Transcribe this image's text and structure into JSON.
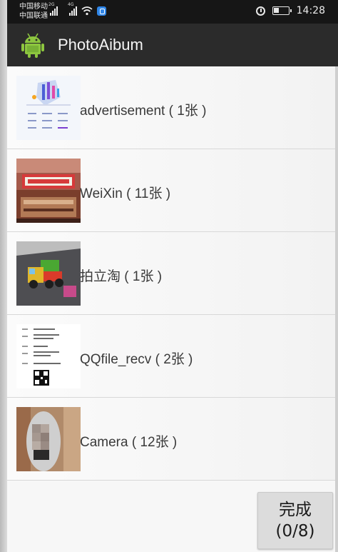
{
  "status_bar": {
    "carrier_1": "中国移动",
    "carrier_2": "中国联通",
    "network_1": "2G",
    "network_2": "4G",
    "time": "14:28"
  },
  "app": {
    "title": "PhotoAibum",
    "icon": "android-robot-icon"
  },
  "albums": [
    {
      "label": "advertisement ( 1张 )",
      "thumb": "advertisement-thumbnail"
    },
    {
      "label": "WeiXin ( 11张 )",
      "thumb": "weixin-thumbnail"
    },
    {
      "label": "拍立淘 ( 1张 )",
      "thumb": "pailitao-thumbnail"
    },
    {
      "label": "QQfile_recv ( 2张 )",
      "thumb": "qqfile-thumbnail"
    },
    {
      "label": "Camera ( 12张 )",
      "thumb": "camera-thumbnail"
    }
  ],
  "done_button": {
    "line1": "完成",
    "line2": "(0/8)"
  },
  "colors": {
    "app_bar": "#2b2b2b",
    "status_bar": "#161616",
    "list_bg": "#f7f7f7",
    "button_bg": "#dcdcdc"
  }
}
